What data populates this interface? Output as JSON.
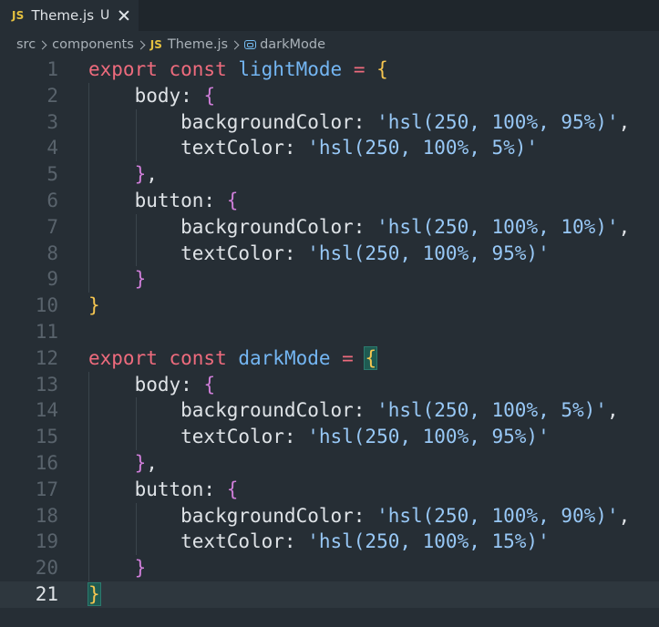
{
  "tab": {
    "icon_text": "JS",
    "icon": "javascript-file-icon",
    "title": "Theme.js",
    "status": "U",
    "close_icon": "close-icon"
  },
  "breadcrumb": {
    "folder1": "src",
    "folder2": "components",
    "file_icon_text": "JS",
    "file": "Theme.js",
    "symbol_icon": "variable-icon",
    "symbol": "darkMode"
  },
  "editor": {
    "current_line": 21,
    "lines": [
      {
        "n": "1",
        "tokens": [
          {
            "t": "export const ",
            "c": "kw"
          },
          {
            "t": "lightMode",
            "c": "fn"
          },
          {
            "t": " = ",
            "c": "op"
          },
          {
            "t": "{",
            "c": "br-y"
          }
        ]
      },
      {
        "n": "2",
        "tokens": [
          {
            "t": "    body: ",
            "c": ""
          },
          {
            "t": "{",
            "c": "br-p"
          }
        ]
      },
      {
        "n": "3",
        "tokens": [
          {
            "t": "        backgroundColor: ",
            "c": ""
          },
          {
            "t": "'hsl(250, 100%, 95%)'",
            "c": "str"
          },
          {
            "t": ",",
            "c": ""
          }
        ]
      },
      {
        "n": "4",
        "tokens": [
          {
            "t": "        textColor: ",
            "c": ""
          },
          {
            "t": "'hsl(250, 100%, 5%)'",
            "c": "str"
          }
        ]
      },
      {
        "n": "5",
        "tokens": [
          {
            "t": "    ",
            "c": ""
          },
          {
            "t": "}",
            "c": "br-p"
          },
          {
            "t": ",",
            "c": ""
          }
        ]
      },
      {
        "n": "6",
        "tokens": [
          {
            "t": "    button: ",
            "c": ""
          },
          {
            "t": "{",
            "c": "br-p"
          }
        ]
      },
      {
        "n": "7",
        "tokens": [
          {
            "t": "        backgroundColor: ",
            "c": ""
          },
          {
            "t": "'hsl(250, 100%, 10%)'",
            "c": "str"
          },
          {
            "t": ",",
            "c": ""
          }
        ]
      },
      {
        "n": "8",
        "tokens": [
          {
            "t": "        textColor: ",
            "c": ""
          },
          {
            "t": "'hsl(250, 100%, 95%)'",
            "c": "str"
          }
        ]
      },
      {
        "n": "9",
        "tokens": [
          {
            "t": "    ",
            "c": ""
          },
          {
            "t": "}",
            "c": "br-p"
          }
        ]
      },
      {
        "n": "10",
        "tokens": [
          {
            "t": "}",
            "c": "br-y"
          }
        ]
      },
      {
        "n": "11",
        "tokens": []
      },
      {
        "n": "12",
        "tokens": [
          {
            "t": "export const ",
            "c": "kw"
          },
          {
            "t": "darkMode",
            "c": "fn"
          },
          {
            "t": " = ",
            "c": "op"
          },
          {
            "t": "{",
            "c": "br-hl"
          }
        ]
      },
      {
        "n": "13",
        "tokens": [
          {
            "t": "    body: ",
            "c": ""
          },
          {
            "t": "{",
            "c": "br-p"
          }
        ]
      },
      {
        "n": "14",
        "tokens": [
          {
            "t": "        backgroundColor: ",
            "c": ""
          },
          {
            "t": "'hsl(250, 100%, 5%)'",
            "c": "str"
          },
          {
            "t": ",",
            "c": ""
          }
        ]
      },
      {
        "n": "15",
        "tokens": [
          {
            "t": "        textColor: ",
            "c": ""
          },
          {
            "t": "'hsl(250, 100%, 95%)'",
            "c": "str"
          }
        ]
      },
      {
        "n": "16",
        "tokens": [
          {
            "t": "    ",
            "c": ""
          },
          {
            "t": "}",
            "c": "br-p"
          },
          {
            "t": ",",
            "c": ""
          }
        ]
      },
      {
        "n": "17",
        "tokens": [
          {
            "t": "    button: ",
            "c": ""
          },
          {
            "t": "{",
            "c": "br-p"
          }
        ]
      },
      {
        "n": "18",
        "tokens": [
          {
            "t": "        backgroundColor: ",
            "c": ""
          },
          {
            "t": "'hsl(250, 100%, 90%)'",
            "c": "str"
          },
          {
            "t": ",",
            "c": ""
          }
        ]
      },
      {
        "n": "19",
        "tokens": [
          {
            "t": "        textColor: ",
            "c": ""
          },
          {
            "t": "'hsl(250, 100%, 15%)'",
            "c": "str"
          }
        ]
      },
      {
        "n": "20",
        "tokens": [
          {
            "t": "    ",
            "c": ""
          },
          {
            "t": "}",
            "c": "br-p"
          }
        ]
      },
      {
        "n": "21",
        "tokens": [
          {
            "t": "}",
            "c": "br-hl"
          }
        ]
      }
    ]
  },
  "colors": {
    "background": "#262e35",
    "keyword": "#ee6b7d",
    "identifier": "#74b6f3",
    "string": "#98c8f6",
    "bracket_level1": "#f6c650",
    "bracket_level2": "#cf7ed9",
    "matched_bracket_bg": "#1f5b52"
  }
}
